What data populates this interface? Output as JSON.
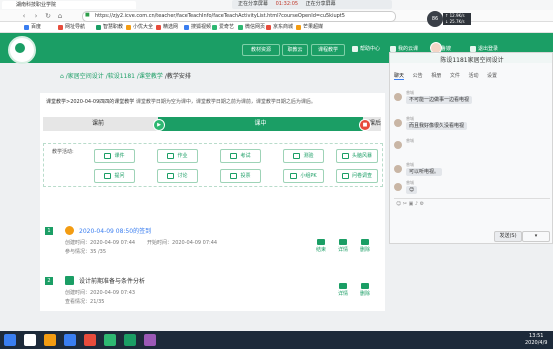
{
  "browser": {
    "tab_title": "湖南科技职业学院",
    "recording": {
      "label": "正在分享屏幕",
      "time": "01:32:05",
      "note": "正在分享屏幕"
    },
    "url": "https://zjy2.icve.com.cn/teacher/faceTeachInfo/faceTeachActivityList.html?courseOpenId=cu5kiupt5",
    "bookmarks": [
      "百度",
      "网址导航",
      "智慧职教",
      "小优大全",
      "精选网",
      "搜狐视频",
      "爱奇艺",
      "微信网页",
      "京东商城",
      "芒果超媒"
    ]
  },
  "header": {
    "buttons": [
      "教材资源",
      "职教云",
      "课程教学"
    ],
    "links": [
      "帮助中心",
      "我的云课",
      "鲁嫂",
      "退出登录"
    ]
  },
  "breadcrumb": {
    "home": "⌂",
    "items": [
      "/家居空间设计",
      "/软设1181",
      "/课堂教学"
    ],
    "current": "/教学安排"
  },
  "class_info": {
    "prefix": "课堂教学>2020-04-09四四的课堂教学",
    "note": "课堂教学日期为空为课中，课堂教学日期之前为课前，课堂教学日期之后为课后。"
  },
  "stages": {
    "before": "课前",
    "during": "课中",
    "after": "课后"
  },
  "activity_label": "教学活动:",
  "activities_row1": [
    "课件",
    "作业",
    "考试",
    "测验",
    "头脑风暴"
  ],
  "activities_row2": [
    "提问",
    "讨论",
    "投票",
    "小组PK",
    "问卷调查"
  ],
  "items": [
    {
      "num": "1",
      "title": "2020-04-09 08:50的签到",
      "created_label": "创建时间：",
      "created": "2020-04-09 07:44",
      "start_label": "开始时间：",
      "start": "2020-04-09 07:44",
      "joined_label": "参与情况：",
      "joined": "35 /35",
      "actions": [
        "结束",
        "详情",
        "删除"
      ]
    },
    {
      "num": "2",
      "title": "设计前期准备与条件分析",
      "created_label": "创建时间：",
      "created": "2020-04-09 07:43",
      "joined_label": "查看情况：",
      "joined": "21/35",
      "actions": [
        "详情",
        "删除"
      ]
    }
  ],
  "chat": {
    "room": "陈设1181家居空间设计",
    "tabs": [
      "聊天",
      "公告",
      "相册",
      "文件",
      "活动",
      "设置"
    ],
    "messages": [
      {
        "name": "曾城",
        "text": "不可能一边做事一边看电视"
      },
      {
        "name": "曾城",
        "text": "而且我好像很久没看电视"
      },
      {
        "name": "曾城",
        "text": ""
      },
      {
        "name": "曾城",
        "text": "可以听电视。"
      },
      {
        "name": "曾城",
        "text": "😊"
      }
    ],
    "send_label": "发送(S)",
    "send_option": "▾"
  },
  "widgets": {
    "gauge": "86",
    "net_up": "↑ 12.9K/s",
    "net_down": "↓ 25.7K/s"
  },
  "taskbar": {
    "time": "13:51",
    "date": "2020/4/9"
  },
  "colors": {
    "brand": "#1b9e65",
    "danger": "#e74c3c"
  }
}
